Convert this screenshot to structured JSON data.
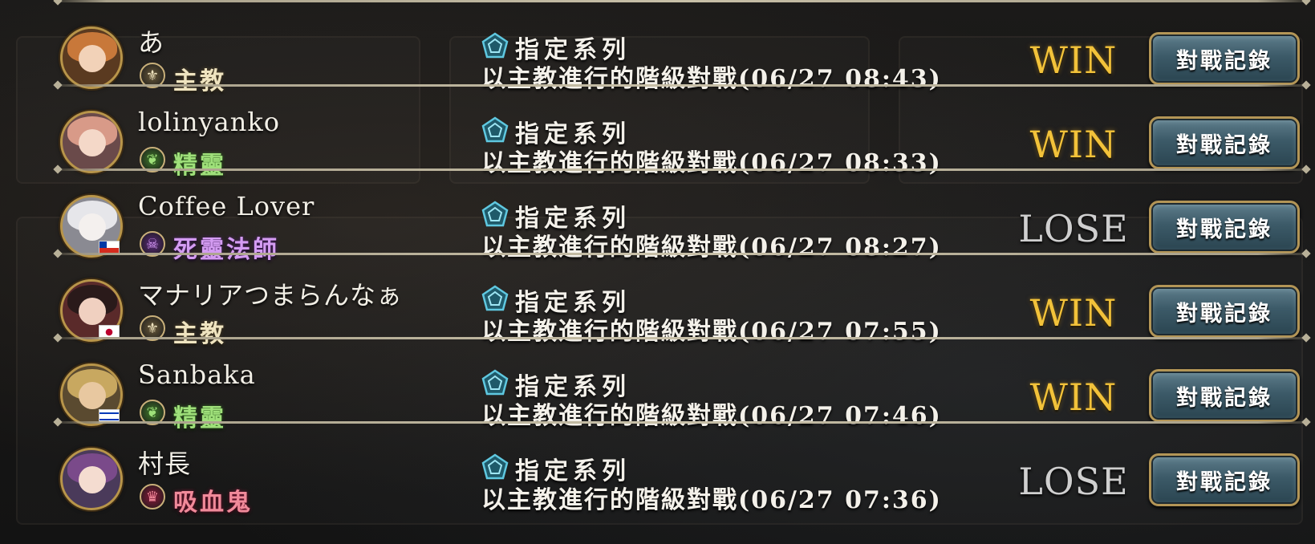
{
  "rows": [
    {
      "player_name": "あ",
      "class": {
        "name": "主教",
        "color": "#efe4c0",
        "icon": "bishop-emblem-icon",
        "glyph": "⚜",
        "icon_bg": "#6a5a3a"
      },
      "format": "指定系列",
      "description": "以主教進行的階級對戰(06/27 08:43)",
      "result": "WIN",
      "button_label": "對戰記錄",
      "flag": null,
      "avatar": {
        "hair": "#c8783a",
        "face": "#f2d2b8",
        "bg": "#5a3a20"
      }
    },
    {
      "player_name": "lolinyanko",
      "class": {
        "name": "精靈",
        "color": "#9fe07a",
        "icon": "elf-leaf-icon",
        "glyph": "❦",
        "icon_bg": "#3f7a2a"
      },
      "format": "指定系列",
      "description": "以主教進行的階級對戰(06/27 08:33)",
      "result": "WIN",
      "button_label": "對戰記錄",
      "flag": null,
      "avatar": {
        "hair": "#d89a88",
        "face": "#f4d8c8",
        "bg": "#6a4a4a"
      }
    },
    {
      "player_name": "Coffee Lover",
      "class": {
        "name": "死靈法師",
        "color": "#d49cf2",
        "icon": "necromancer-skull-icon",
        "glyph": "☠",
        "icon_bg": "#5a2a7a"
      },
      "format": "指定系列",
      "description": "以主教進行的階級對戰(06/27 08:27)",
      "result": "LOSE",
      "button_label": "對戰記錄",
      "flag": "chile-flag-icon",
      "avatar": {
        "hair": "#e6e6ea",
        "face": "#f4f0ee",
        "bg": "#8a8a92"
      }
    },
    {
      "player_name": "マナリアつまらんなぁ",
      "class": {
        "name": "主教",
        "color": "#efe4c0",
        "icon": "bishop-emblem-icon",
        "glyph": "⚜",
        "icon_bg": "#6a5a3a"
      },
      "format": "指定系列",
      "description": "以主教進行的階級對戰(06/27 07:55)",
      "result": "WIN",
      "button_label": "對戰記錄",
      "flag": "japan-flag-icon",
      "avatar": {
        "hair": "#2a1a1a",
        "face": "#f0d0c0",
        "bg": "#5a2a2a"
      }
    },
    {
      "player_name": "Sanbaka",
      "class": {
        "name": "精靈",
        "color": "#9fe07a",
        "icon": "elf-leaf-icon",
        "glyph": "❦",
        "icon_bg": "#3f7a2a"
      },
      "format": "指定系列",
      "description": "以主教進行的階級對戰(06/27 07:46)",
      "result": "WIN",
      "button_label": "對戰記錄",
      "flag": "israel-flag-icon",
      "avatar": {
        "hair": "#c8a860",
        "face": "#e8c8a0",
        "bg": "#5a4a30"
      }
    },
    {
      "player_name": "村長",
      "class": {
        "name": "吸血鬼",
        "color": "#f08a9a",
        "icon": "vampire-emblem-icon",
        "glyph": "♛",
        "icon_bg": "#8a1a3a"
      },
      "format": "指定系列",
      "description": "以主教進行的階級對戰(06/27 07:36)",
      "result": "LOSE",
      "button_label": "對戰記錄",
      "flag": null,
      "avatar": {
        "hair": "#7a4a8a",
        "face": "#f4dcd0",
        "bg": "#4a3a5a"
      }
    }
  ],
  "colors": {
    "win": "#f2c23a",
    "lose": "#cfcfcf",
    "button_face": "#3c5a68",
    "button_border": "#b39556",
    "format_icon": "#5fc8e0"
  }
}
